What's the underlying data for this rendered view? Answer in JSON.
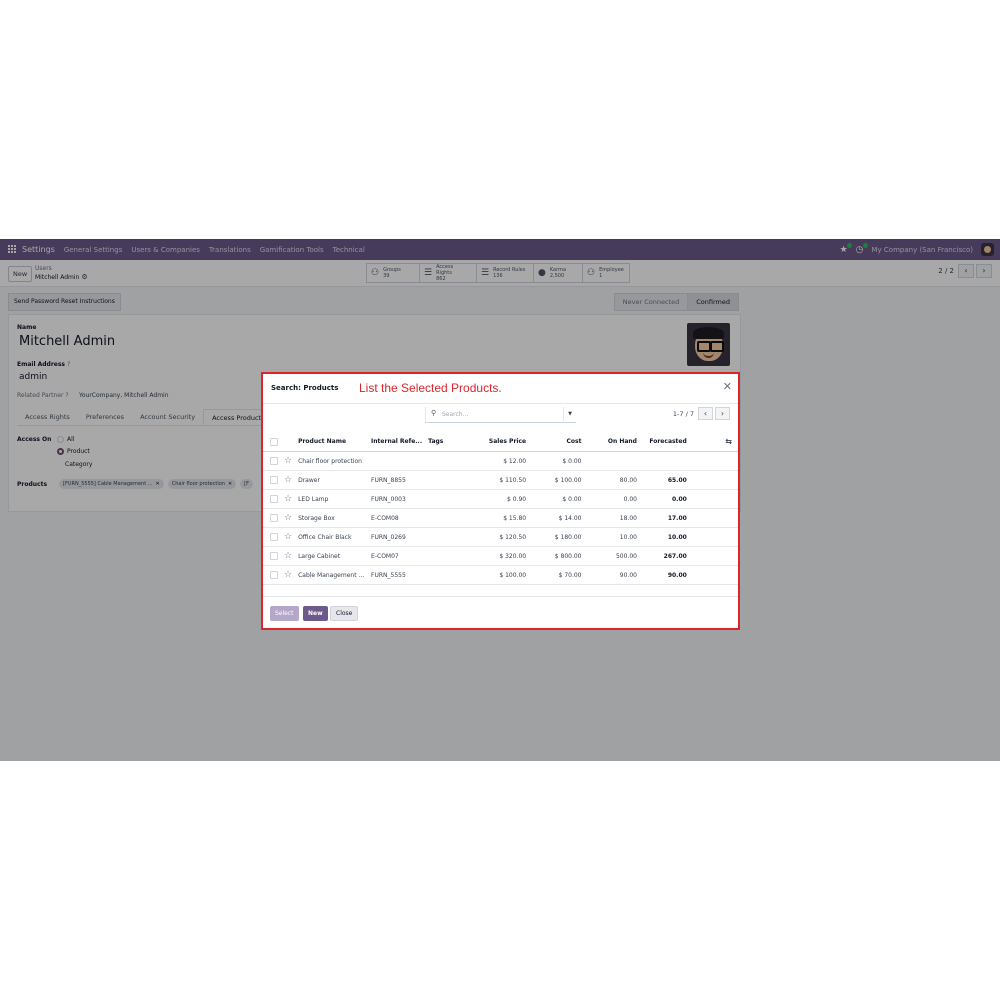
{
  "navbar": {
    "app_name": "Settings",
    "menus": [
      "General Settings",
      "Users & Companies",
      "Translations",
      "Gamification Tools",
      "Technical"
    ],
    "company": "My Company (San Francisco)"
  },
  "control_panel": {
    "new_label": "New",
    "breadcrumb_parent": "Users",
    "breadcrumb_current": "Mitchell Admin",
    "smart_buttons": [
      {
        "label": "Groups",
        "value": "39",
        "icon": "users-icon"
      },
      {
        "label": "Access Rights",
        "value": "862",
        "icon": "list-icon"
      },
      {
        "label": "Record Rules",
        "value": "136",
        "icon": "list-icon"
      },
      {
        "label": "Karma",
        "value": "2,500",
        "icon": "karma-icon"
      },
      {
        "label": "Employee",
        "value": "1",
        "icon": "users-icon"
      }
    ],
    "pager": "2 / 2"
  },
  "statusbar": {
    "reset_button": "Send Password Reset Instructions",
    "stages": [
      "Never Connected",
      "Confirmed"
    ],
    "active_stage": "Confirmed"
  },
  "form": {
    "name_label": "Name",
    "name_value": "Mitchell Admin",
    "email_label": "Email Address",
    "required_mark": "?",
    "email_value": "admin",
    "related_partner_label": "Related Partner",
    "related_partner_value": "YourCompany, Mitchell Admin",
    "tabs": [
      "Access Rights",
      "Preferences",
      "Account Security",
      "Access Products"
    ],
    "active_tab": "Access Products",
    "access_on_label": "Access On",
    "access_options": [
      "All",
      "Product",
      "Category"
    ],
    "access_selected": "Product",
    "products_label": "Products",
    "product_tags": [
      "[FURN_5555] Cable Management ...",
      "Chair floor protection",
      "[F"
    ]
  },
  "modal": {
    "title": "Search: Products",
    "annotation": "List the Selected Products.",
    "search_placeholder": "Search...",
    "pager": "1-7 / 7",
    "columns": [
      "Product Name",
      "Internal Refe...",
      "Tags",
      "Sales Price",
      "Cost",
      "On Hand",
      "Forecasted"
    ],
    "rows": [
      {
        "name": "Chair floor protection",
        "ref": "",
        "tags": "",
        "price": "$ 12.00",
        "cost": "$ 0.00",
        "onhand": "",
        "forecast": ""
      },
      {
        "name": "Drawer",
        "ref": "FURN_8855",
        "tags": "",
        "price": "$ 110.50",
        "cost": "$ 100.00",
        "onhand": "80.00",
        "forecast": "65.00"
      },
      {
        "name": "LED Lamp",
        "ref": "FURN_0003",
        "tags": "",
        "price": "$ 0.90",
        "cost": "$ 0.00",
        "onhand": "0.00",
        "forecast": "0.00"
      },
      {
        "name": "Storage Box",
        "ref": "E-COM08",
        "tags": "",
        "price": "$ 15.80",
        "cost": "$ 14.00",
        "onhand": "18.00",
        "forecast": "17.00"
      },
      {
        "name": "Office Chair Black",
        "ref": "FURN_0269",
        "tags": "",
        "price": "$ 120.50",
        "cost": "$ 180.00",
        "onhand": "10.00",
        "forecast": "10.00"
      },
      {
        "name": "Large Cabinet",
        "ref": "E-COM07",
        "tags": "",
        "price": "$ 320.00",
        "cost": "$ 800.00",
        "onhand": "500.00",
        "forecast": "267.00"
      },
      {
        "name": "Cable Management ...",
        "ref": "FURN_5555",
        "tags": "",
        "price": "$ 100.00",
        "cost": "$ 70.00",
        "onhand": "90.00",
        "forecast": "90.00"
      }
    ],
    "buttons": {
      "select": "Select",
      "new": "New",
      "close": "Close"
    }
  },
  "colors": {
    "navbar": "#6c5a8a",
    "accent": "#714b67",
    "annotation": "#d9262b"
  }
}
